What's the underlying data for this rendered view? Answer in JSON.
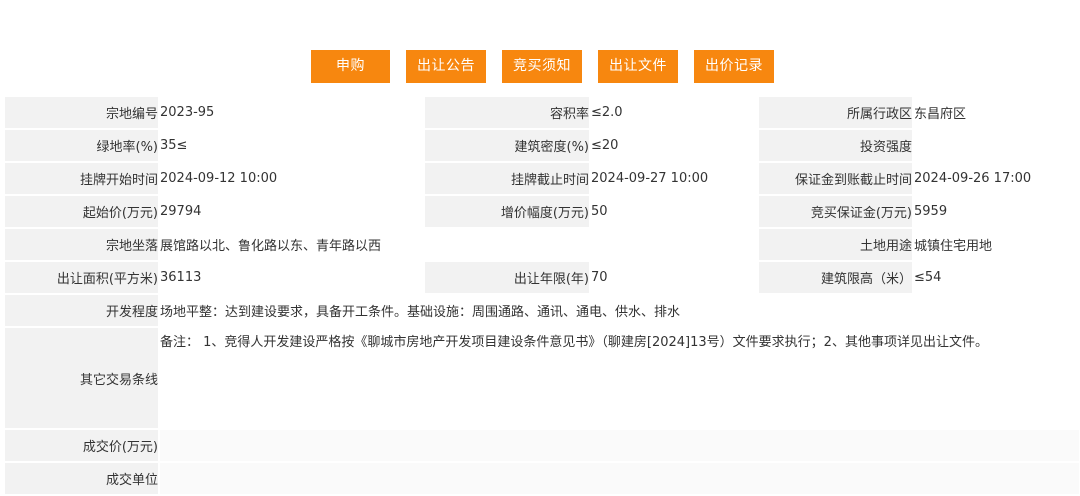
{
  "buttons": {
    "apply": "申购",
    "announcement": "出让公告",
    "notice": "竞买须知",
    "documents": "出让文件",
    "bid_record": "出价记录"
  },
  "parcel": {
    "row1": {
      "l1": "宗地编号",
      "v1": "2023-95",
      "l2": "容积率",
      "v2": "≤2.0",
      "l3": "所属行政区",
      "v3": "东昌府区"
    },
    "row2": {
      "l1": "绿地率(%)",
      "v1": "35≤",
      "l2": "建筑密度(%)",
      "v2": "≤20",
      "l3": "投资强度",
      "v3": ""
    },
    "row3": {
      "l1": "挂牌开始时间",
      "v1": "2024-09-12 10:00",
      "l2": "挂牌截止时间",
      "v2": "2024-09-27 10:00",
      "l3": "保证金到账截止时间",
      "v3": "2024-09-26 17:00"
    },
    "row4": {
      "l1": "起始价(万元)",
      "v1": "29794",
      "l2": "增价幅度(万元)",
      "v2": "50",
      "l3": "竞买保证金(万元)",
      "v3": "5959"
    },
    "row5": {
      "l1": "宗地坐落",
      "v1": "展馆路以北、鲁化路以东、青年路以西",
      "l3": "土地用途",
      "v3": "城镇住宅用地"
    },
    "row6": {
      "l1": "出让面积(平方米)",
      "v1": "36113",
      "l2": "出让年限(年)",
      "v2": "70",
      "l3": "建筑限高（米）",
      "v3": "≤54"
    },
    "row7": {
      "l1": "开发程度",
      "v1": "场地平整：达到建设要求，具备开工条件。基础设施：周围通路、通讯、通电、供水、排水"
    },
    "row8": {
      "l1": "其它交易条线",
      "v1": "备注： 1、竞得人开发建设严格按《聊城市房地产开发项目建设条件意见书》（聊建房[2024]13号）文件要求执行；2、其他事项详见出让文件。"
    },
    "row9": {
      "l1": "成交价(万元)",
      "v1": ""
    },
    "row10": {
      "l1": "成交单位",
      "v1": ""
    }
  }
}
